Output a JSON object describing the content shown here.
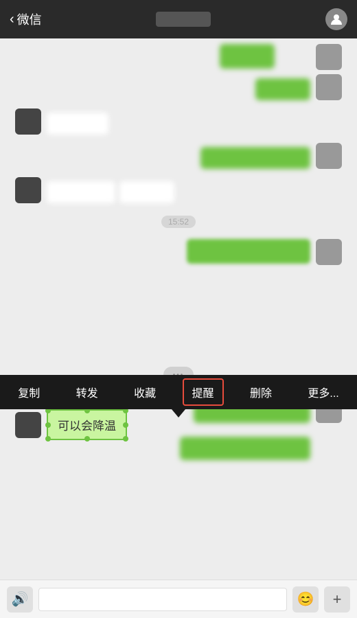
{
  "header": {
    "back_label": "微信",
    "title_placeholder": "",
    "profile_icon": "person"
  },
  "chat": {
    "time_label": "15:52",
    "context_menu": {
      "items": [
        "复制",
        "转发",
        "收藏",
        "提醒",
        "删除",
        "更多..."
      ],
      "active_index": 3
    },
    "selected_bubble_text": "可以会降温",
    "typing_indicator": ""
  },
  "bottom_bar": {
    "voice_icon": "🔊",
    "input_placeholder": "",
    "emoji_icon": "😊",
    "add_icon": "+"
  }
}
